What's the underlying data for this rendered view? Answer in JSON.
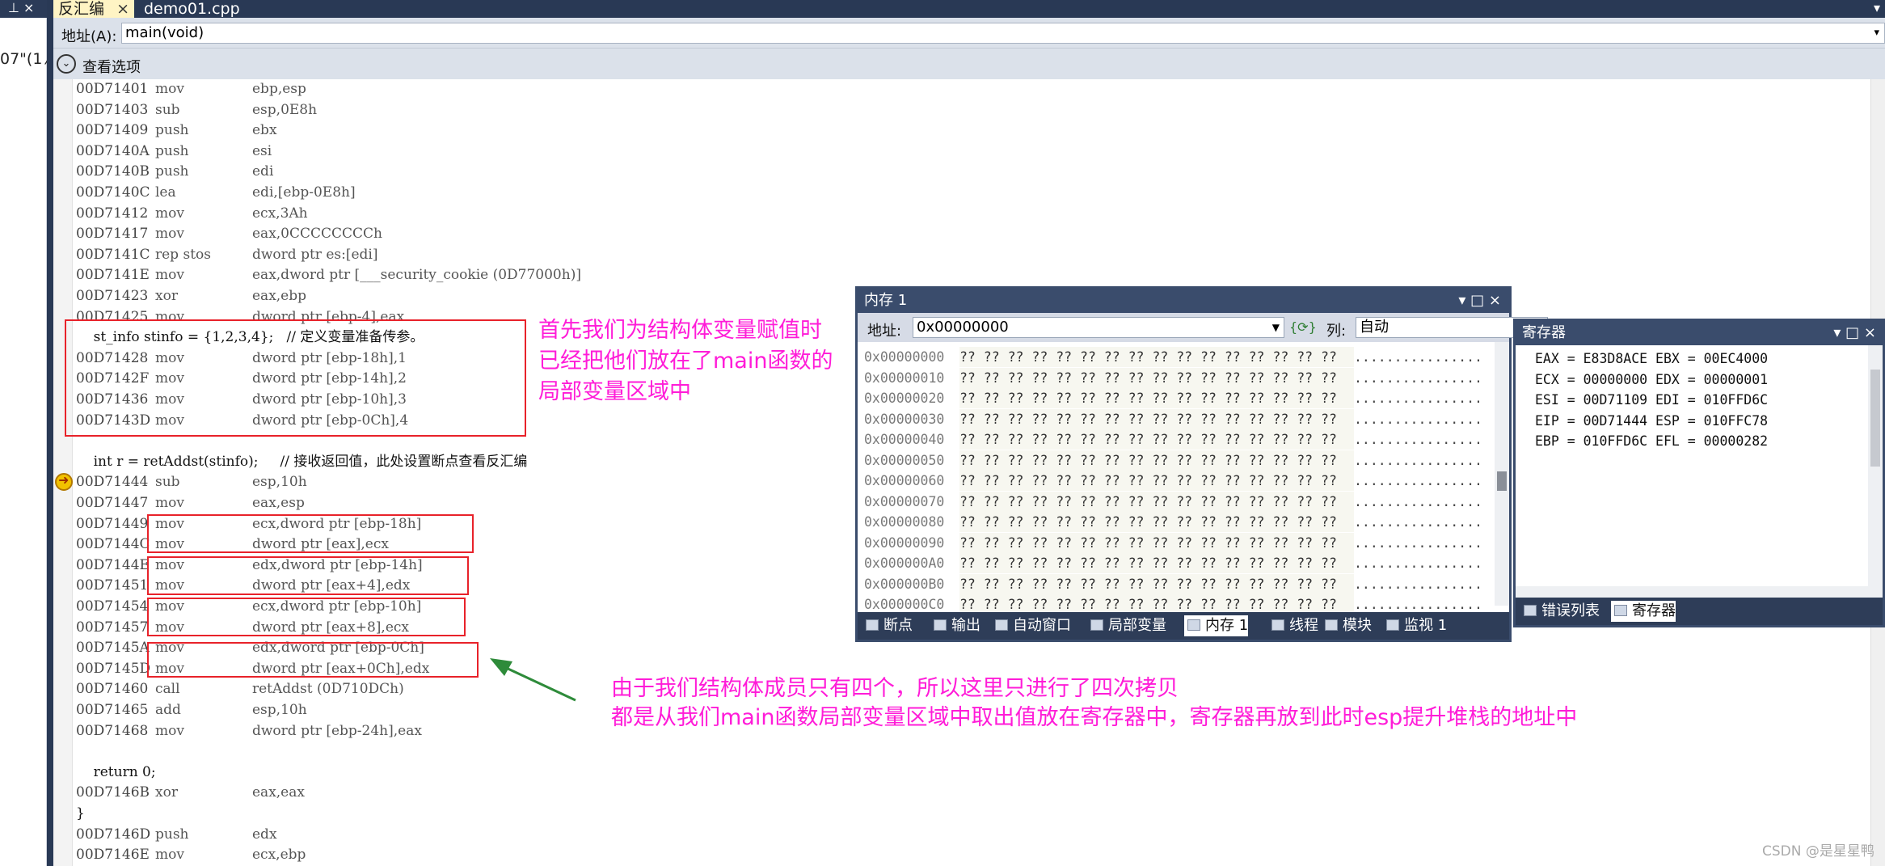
{
  "left_strip": {
    "text": "07\"(1 ⁄",
    "pin": "⊥ ×"
  },
  "tabs": [
    {
      "label": "反汇编",
      "close": "×"
    },
    {
      "label": "demo01.cpp"
    }
  ],
  "tab_dropdown": "▾",
  "address": {
    "label": "地址(A):",
    "value": "main(void)",
    "dropdown": "▾"
  },
  "view_options": {
    "icon": "⌄",
    "label": "查看选项"
  },
  "disasm": [
    {
      "addr": "00D71401",
      "mn": "mov",
      "op": "ebp,esp"
    },
    {
      "addr": "00D71403",
      "mn": "sub",
      "op": "esp,0E8h"
    },
    {
      "addr": "00D71409",
      "mn": "push",
      "op": "ebx"
    },
    {
      "addr": "00D7140A",
      "mn": "push",
      "op": "esi"
    },
    {
      "addr": "00D7140B",
      "mn": "push",
      "op": "edi"
    },
    {
      "addr": "00D7140C",
      "mn": "lea",
      "op": "edi,[ebp-0E8h]"
    },
    {
      "addr": "00D71412",
      "mn": "mov",
      "op": "ecx,3Ah"
    },
    {
      "addr": "00D71417",
      "mn": "mov",
      "op": "eax,0CCCCCCCCh"
    },
    {
      "addr": "00D7141C",
      "mn": "rep stos",
      "op": "dword ptr es:[edi]"
    },
    {
      "addr": "00D7141E",
      "mn": "mov",
      "op": "eax,dword ptr [___security_cookie (0D77000h)]"
    },
    {
      "addr": "00D71423",
      "mn": "xor",
      "op": "eax,ebp"
    },
    {
      "addr": "00D71425",
      "mn": "mov",
      "op": "dword ptr [ebp-4],eax"
    },
    {
      "src": "    st_info stinfo = {1,2,3,4};   // 定义变量准备传参。"
    },
    {
      "addr": "00D71428",
      "mn": "mov",
      "op": "dword ptr [ebp-18h],1"
    },
    {
      "addr": "00D7142F",
      "mn": "mov",
      "op": "dword ptr [ebp-14h],2"
    },
    {
      "addr": "00D71436",
      "mn": "mov",
      "op": "dword ptr [ebp-10h],3"
    },
    {
      "addr": "00D7143D",
      "mn": "mov",
      "op": "dword ptr [ebp-0Ch],4"
    },
    {
      "src": ""
    },
    {
      "src": "    int r = retAddst(stinfo);     // 接收返回值，此处设置断点查看反汇编"
    },
    {
      "addr": "00D71444",
      "mn": "sub",
      "op": "esp,10h"
    },
    {
      "addr": "00D71447",
      "mn": "mov",
      "op": "eax,esp"
    },
    {
      "addr": "00D71449",
      "mn": "mov",
      "op": "ecx,dword ptr [ebp-18h]"
    },
    {
      "addr": "00D7144C",
      "mn": "mov",
      "op": "dword ptr [eax],ecx"
    },
    {
      "addr": "00D7144E",
      "mn": "mov",
      "op": "edx,dword ptr [ebp-14h]"
    },
    {
      "addr": "00D71451",
      "mn": "mov",
      "op": "dword ptr [eax+4],edx"
    },
    {
      "addr": "00D71454",
      "mn": "mov",
      "op": "ecx,dword ptr [ebp-10h]"
    },
    {
      "addr": "00D71457",
      "mn": "mov",
      "op": "dword ptr [eax+8],ecx"
    },
    {
      "addr": "00D7145A",
      "mn": "mov",
      "op": "edx,dword ptr [ebp-0Ch]"
    },
    {
      "addr": "00D7145D",
      "mn": "mov",
      "op": "dword ptr [eax+0Ch],edx"
    },
    {
      "addr": "00D71460",
      "mn": "call",
      "op": "retAddst (0D710DCh)"
    },
    {
      "addr": "00D71465",
      "mn": "add",
      "op": "esp,10h"
    },
    {
      "addr": "00D71468",
      "mn": "mov",
      "op": "dword ptr [ebp-24h],eax"
    },
    {
      "src": ""
    },
    {
      "src": "    return 0;"
    },
    {
      "addr": "00D7146B",
      "mn": "xor",
      "op": "eax,eax"
    },
    {
      "src": "}"
    },
    {
      "addr": "00D7146D",
      "mn": "push",
      "op": "edx"
    },
    {
      "addr": "00D7146E",
      "mn": "mov",
      "op": "ecx,ebp"
    }
  ],
  "annotations": {
    "top": [
      "首先我们为结构体变量赋值时",
      "已经把他们放在了main函数的",
      "局部变量区域中"
    ],
    "bottom": [
      "由于我们结构体成员只有四个，所以这里只进行了四次拷贝",
      "都是从我们main函数局部变量区域中取出值放在寄存器中，寄存器再放到此时esp提升堆栈的地址中"
    ]
  },
  "memory": {
    "title": "内存 1",
    "controls": "▾ □ ×",
    "addr_label": "地址:",
    "addr_value": "0x00000000",
    "refresh": "{⟳}",
    "col_label": "列:",
    "col_value": "自动",
    "hex": "?? ?? ?? ?? ?? ?? ?? ?? ?? ?? ?? ?? ?? ?? ?? ??",
    "ascii": "................",
    "rows": [
      "0x00000000",
      "0x00000010",
      "0x00000020",
      "0x00000030",
      "0x00000040",
      "0x00000050",
      "0x00000060",
      "0x00000070",
      "0x00000080",
      "0x00000090",
      "0x000000A0",
      "0x000000B0",
      "0x000000C0"
    ]
  },
  "memory_tabs": [
    "断点",
    "输出",
    "自动窗口",
    "局部变量",
    "内存 1",
    "线程",
    "模块",
    "监视 1"
  ],
  "registers": {
    "title": "寄存器",
    "controls": "▾ □ ×",
    "lines": [
      "EAX = E83D8ACE EBX = 00EC4000",
      "ECX = 00000000 EDX = 00000001",
      "ESI = 00D71109 EDI = 010FFD6C",
      "EIP = 00D71444 ESP = 010FFC78",
      "EBP = 010FFD6C EFL = 00000282"
    ]
  },
  "register_tabs": [
    "错误列表",
    "寄存器"
  ],
  "watermark": "CSDN @是星星鸭",
  "colors": {
    "annotation": "#ff1cd8",
    "highlight_box": "#e8222a",
    "arrow": "#2e8b3a",
    "titlebar": "#293955",
    "tab_active": "#fff4c4"
  }
}
